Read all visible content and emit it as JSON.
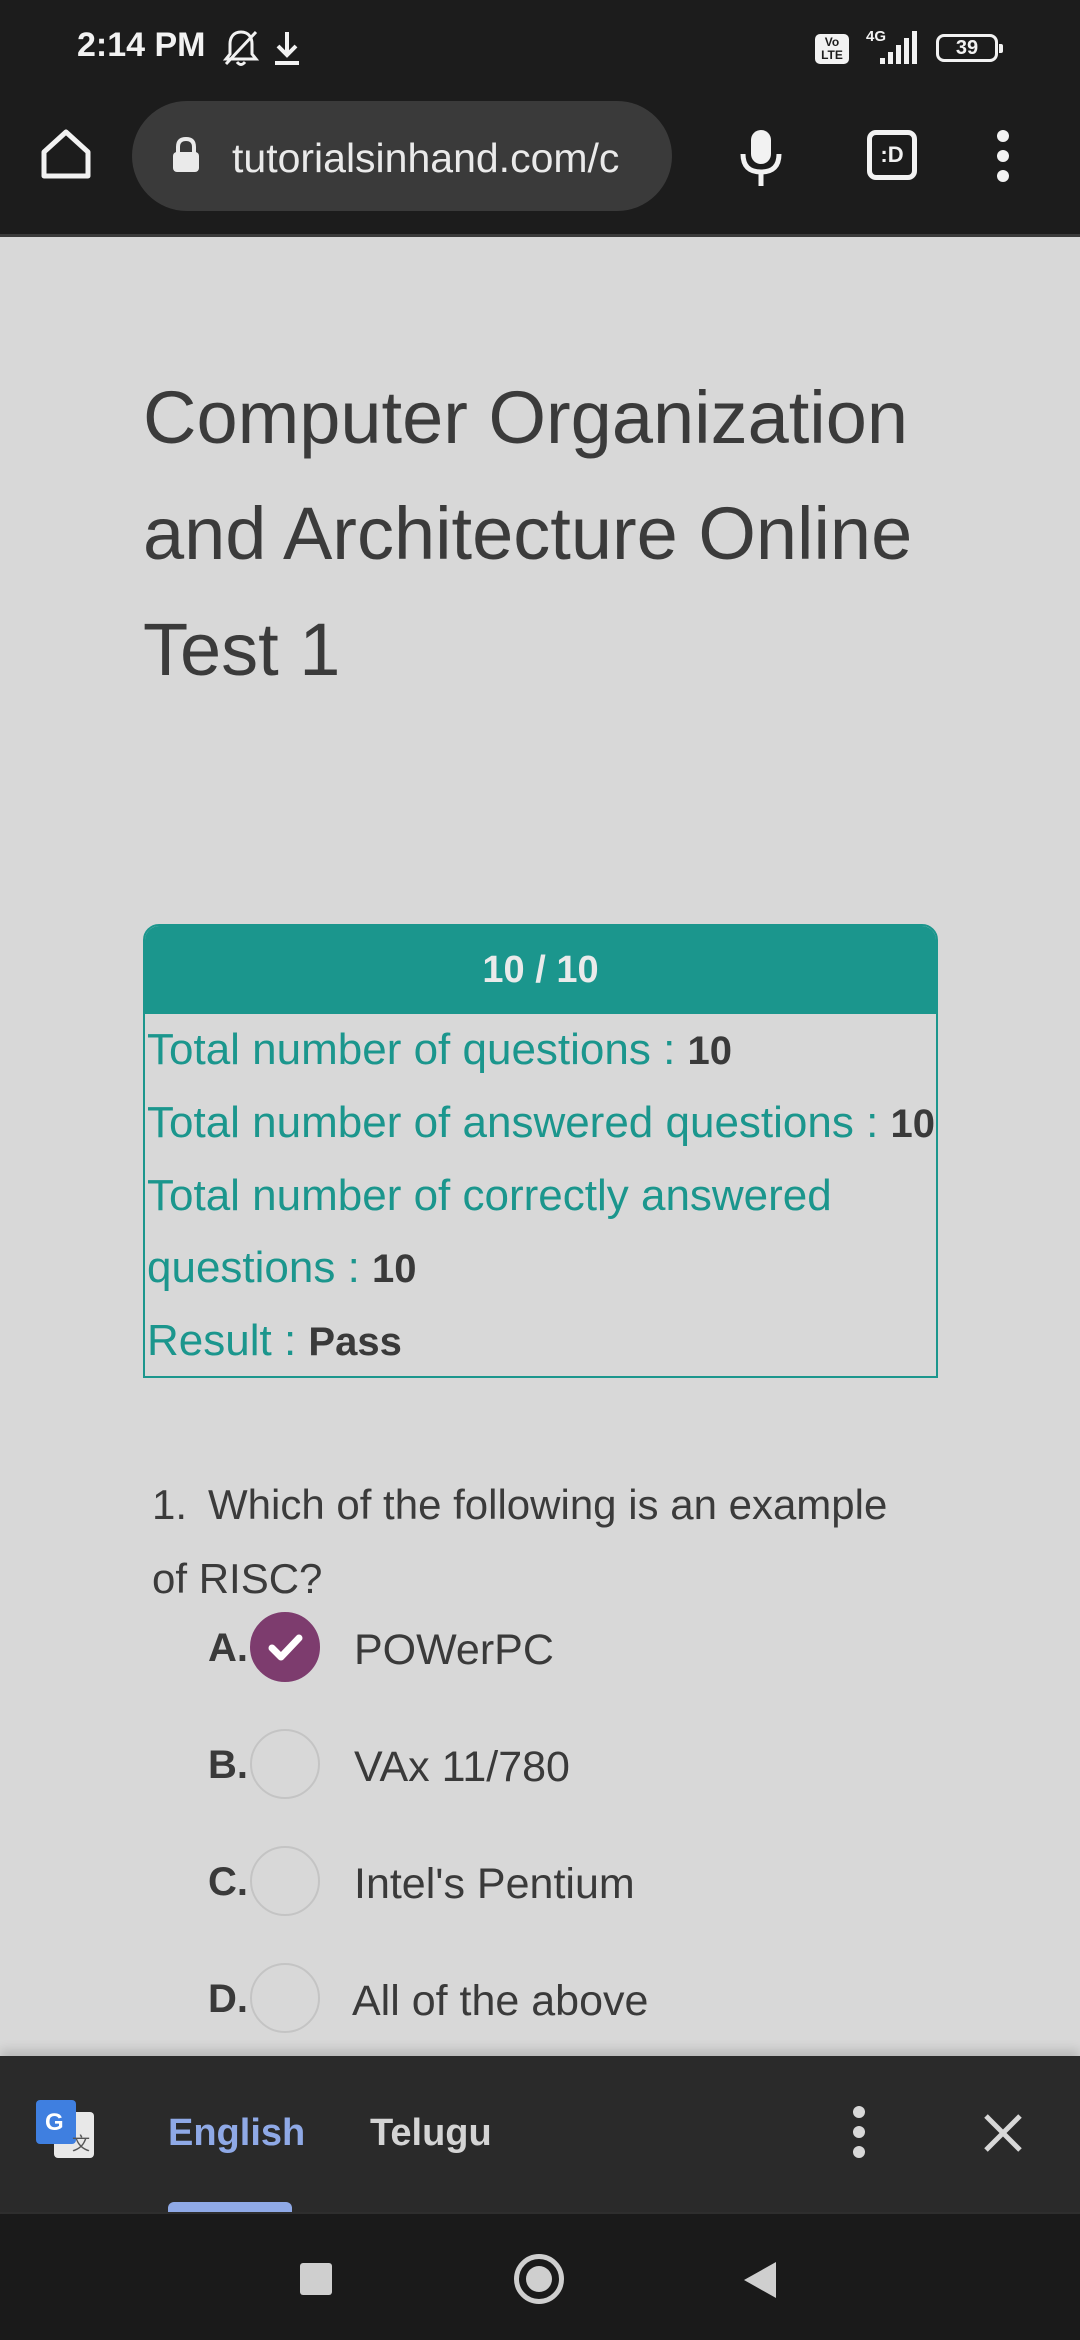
{
  "status_bar": {
    "time": "2:14 PM",
    "icons": [
      "notifications-off-icon",
      "download-icon",
      "volte-icon",
      "signal-icon"
    ],
    "network": "4G",
    "volte": "Vo LTE",
    "battery": "39"
  },
  "browser": {
    "url": "tutorialsinhand.com/c",
    "icons": [
      "home-icon",
      "lock-icon",
      "mic-icon",
      "tab-switcher-icon",
      "more-vert-icon"
    ],
    "tab_switcher_label": ":D"
  },
  "page": {
    "title": "Computer Organization and Architecture Online Test 1",
    "result": {
      "score": "10 / 10",
      "lines": [
        {
          "label": "Total number of questions : ",
          "value": "10"
        },
        {
          "label": "Total number of answered questions : ",
          "value": "10"
        },
        {
          "label": "Total number of correctly answered questions : ",
          "value": "10"
        },
        {
          "label": "Result : ",
          "value": "Pass"
        }
      ]
    },
    "question": {
      "number": "1.",
      "text": "Which of the following is an example of RISC?",
      "options": [
        {
          "letter": "A.",
          "label": "POWerPC",
          "selected": true
        },
        {
          "letter": "B.",
          "label": "VAx 11/780",
          "selected": false
        },
        {
          "letter": "C.",
          "label": "Intel's Pentium",
          "selected": false
        },
        {
          "letter": "D.",
          "label": "All of the above",
          "selected": false
        }
      ]
    }
  },
  "translate_bar": {
    "languages": [
      "English",
      "Telugu"
    ],
    "active": "English",
    "icons": [
      "google-translate-icon",
      "more-vert-icon",
      "close-icon"
    ]
  },
  "nav_bar": {
    "icons": [
      "recents-icon",
      "home-icon",
      "back-icon"
    ]
  },
  "colors": {
    "accent": "#1b968d",
    "selected": "#7d3c6e",
    "active_language": "#8fa9e6"
  }
}
